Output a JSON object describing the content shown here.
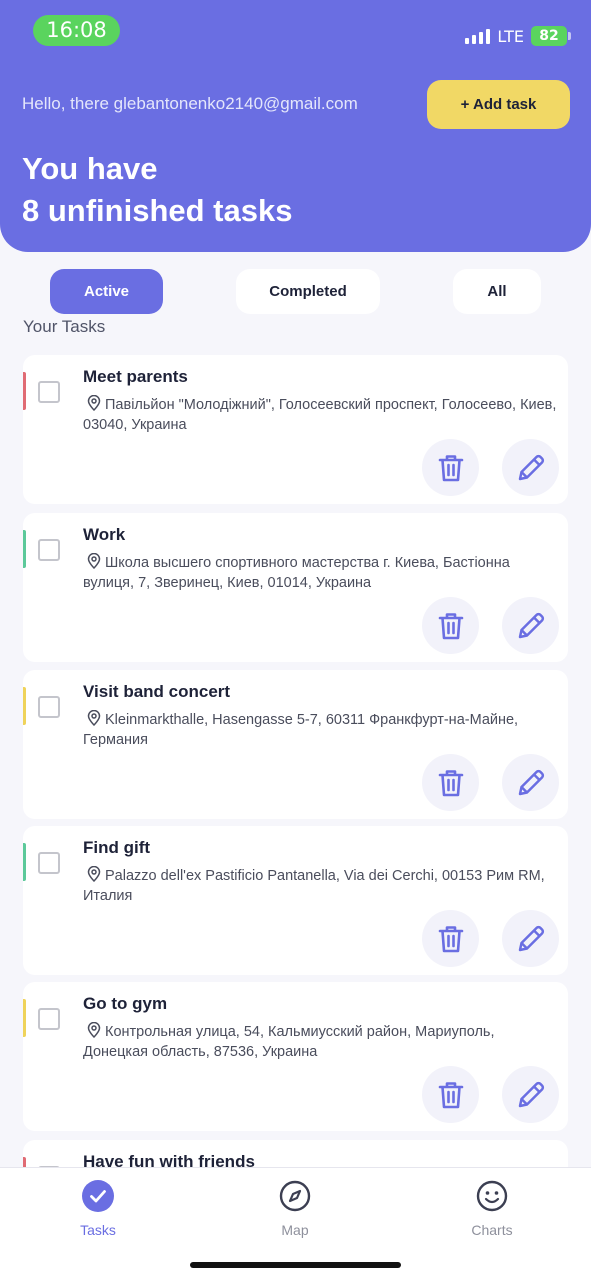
{
  "status_bar": {
    "time": "16:08",
    "network": "LTE",
    "battery": "82"
  },
  "header": {
    "greeting": "Hello, there glebantonenko2140@gmail.com",
    "add_task_label": "+ Add task",
    "title_line1": "You have",
    "title_line2": "8 unfinished tasks"
  },
  "filters": {
    "active": "Active",
    "completed": "Completed",
    "all": "All",
    "selected": "Active"
  },
  "section_label": "Your Tasks",
  "tasks": [
    {
      "title": "Meet parents",
      "address": "Павільйон \"Молодіжний\", Голосеевский проспект, Голосеево, Киев, 03040, Украина",
      "color": "#e06b74"
    },
    {
      "title": "Work",
      "address": "Школа высшего спортивного мастерства г. Киева, Бастіонна вулиця, 7, Зверинец, Киев, 01014, Украина",
      "color": "#5cc99a"
    },
    {
      "title": "Visit band concert",
      "address": "Kleinmarkthalle, Hasengasse 5-7, 60311 Франкфурт-на-Майне, Германия",
      "color": "#efd35a"
    },
    {
      "title": "Find gift",
      "address": "Palazzo dell'ex Pastificio Pantanella, Via dei Cerchi, 00153 Рим RM, Италия",
      "color": "#5cc99a"
    },
    {
      "title": "Go to gym",
      "address": "Контрольная улица, 54, Кальмиусский район, Мариуполь, Донецкая область, 87536, Украина",
      "color": "#efd35a"
    },
    {
      "title": "Have fun with friends",
      "address": "",
      "color": "#e06b74"
    }
  ],
  "nav": {
    "tasks": "Tasks",
    "map": "Map",
    "charts": "Charts"
  },
  "colors": {
    "primary": "#6a6ee2",
    "accent_yellow": "#f1d865",
    "background": "#f6f6fb"
  }
}
